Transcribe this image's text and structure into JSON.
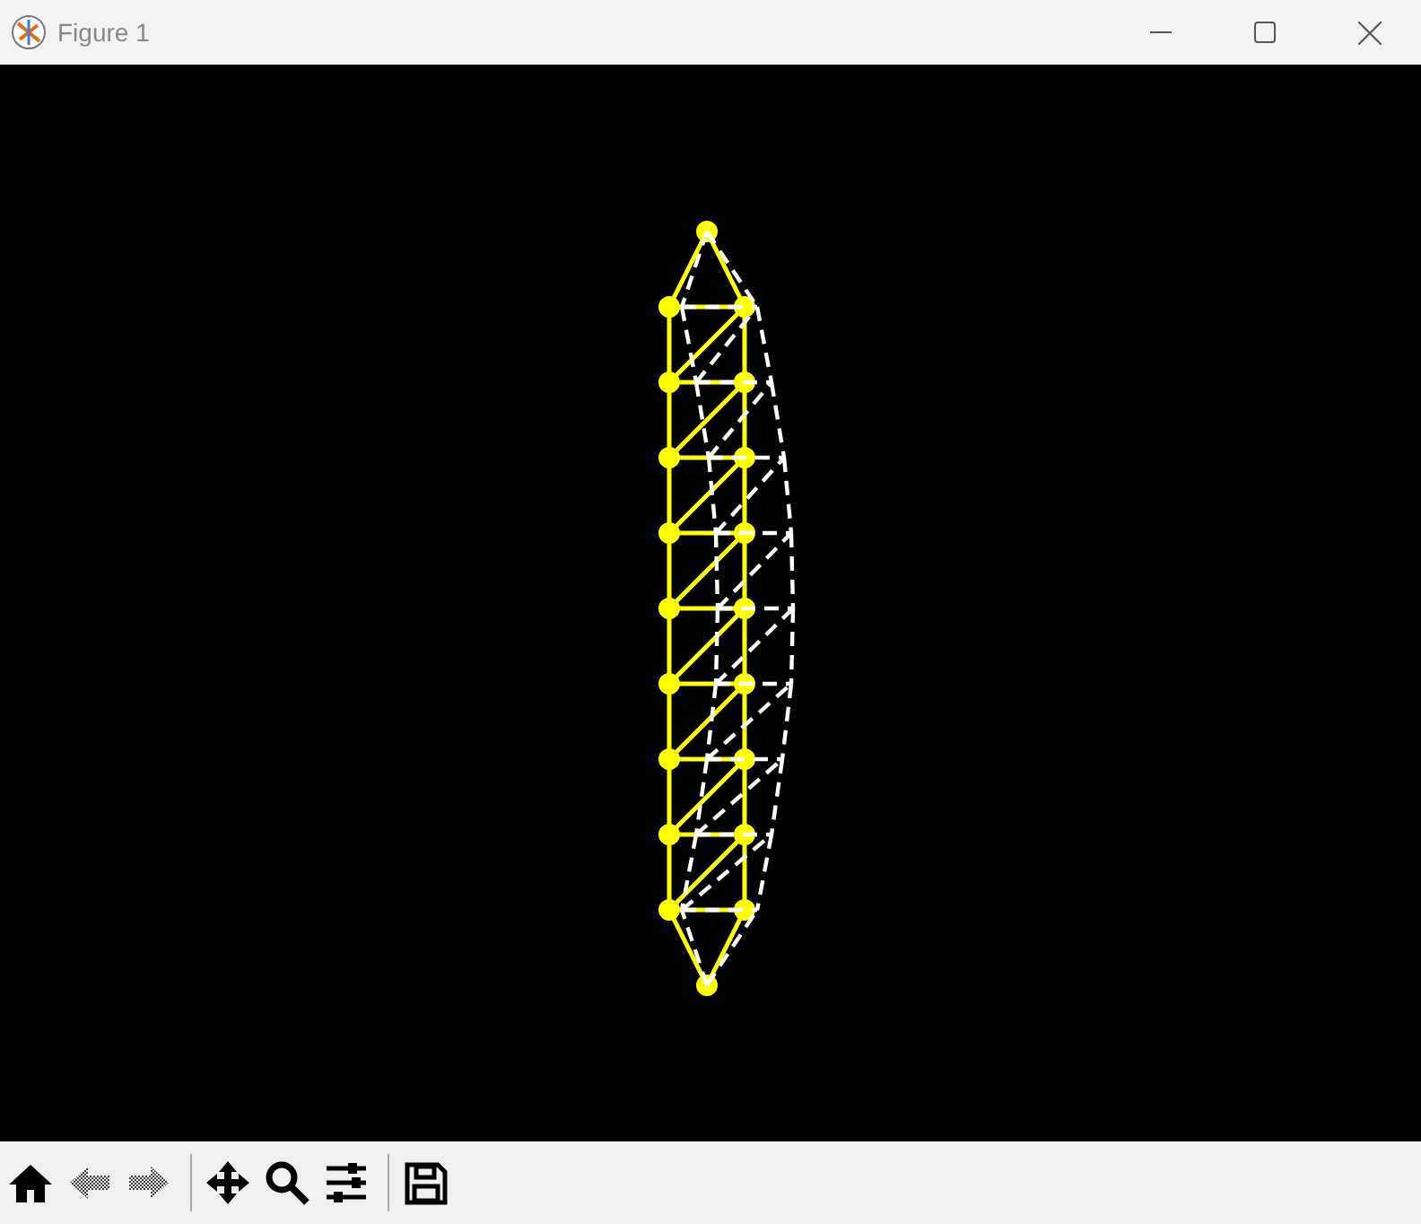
{
  "window": {
    "title": "Figure 1"
  },
  "toolbar": [
    {
      "kind": "home",
      "disabled": false
    },
    {
      "kind": "back",
      "disabled": true
    },
    {
      "kind": "forward",
      "disabled": true
    },
    {
      "kind": "separator"
    },
    {
      "kind": "pan",
      "disabled": false
    },
    {
      "kind": "zoom",
      "disabled": false
    },
    {
      "kind": "configure",
      "disabled": false
    },
    {
      "kind": "separator"
    },
    {
      "kind": "save",
      "disabled": false
    }
  ]
}
